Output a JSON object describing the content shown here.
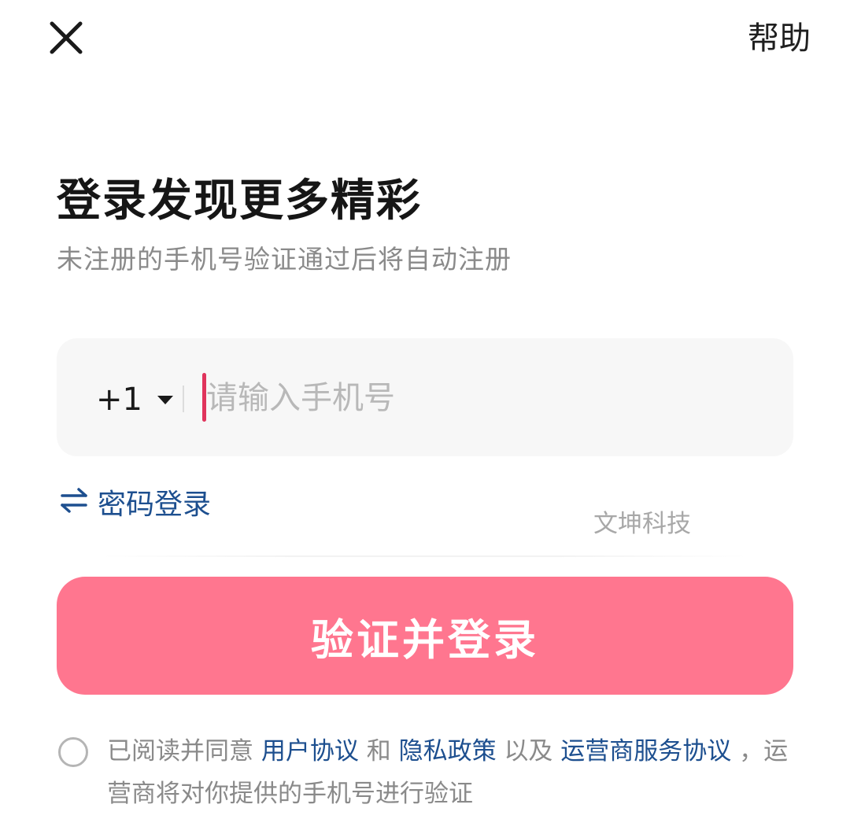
{
  "header": {
    "close_icon": "close-icon",
    "help_label": "帮助"
  },
  "main": {
    "title": "登录发现更多精彩",
    "subtitle": "未注册的手机号验证通过后将自动注册"
  },
  "phone": {
    "country_code": "+1",
    "dropdown_icon": "caret-down-icon",
    "placeholder": "请输入手机号",
    "value": ""
  },
  "password_login": {
    "icon": "swap-arrows-icon",
    "label": "密码登录"
  },
  "watermark": "文坤科技",
  "submit": {
    "label": "验证并登录"
  },
  "agreement": {
    "prefix": "已阅读并同意 ",
    "user_agreement": "用户协议",
    "and": " 和 ",
    "privacy_policy": "隐私政策",
    "and_also": " 以及 ",
    "carrier_agreement": "运营商服务协议",
    "suffix": " ，运营商将对你提供的手机号进行验证"
  },
  "colors": {
    "accent_pink": "#ff768f",
    "caret_red": "#e0345c",
    "link_blue": "#1d4f8f"
  }
}
